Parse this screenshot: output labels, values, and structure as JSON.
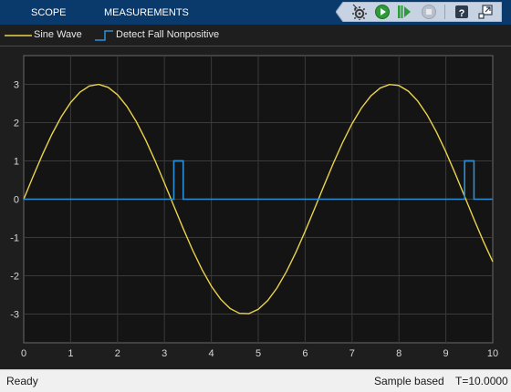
{
  "toolstrip": {
    "tabs": [
      {
        "label": "SCOPE"
      },
      {
        "label": "MEASUREMENTS"
      }
    ],
    "buttons": [
      {
        "name": "settings-button",
        "icon": "gear-icon"
      },
      {
        "name": "run-button",
        "icon": "play-icon"
      },
      {
        "name": "step-forward-button",
        "icon": "step-forward-icon"
      },
      {
        "name": "stop-button",
        "icon": "stop-icon"
      },
      {
        "name": "help-button",
        "icon": "help-icon"
      },
      {
        "name": "undock-button",
        "icon": "undock-icon"
      }
    ]
  },
  "legend": {
    "items": [
      {
        "label": "Sine Wave",
        "color": "#e9d24c"
      },
      {
        "label": "Detect Fall Nonpositive",
        "color": "#2c8fd6"
      }
    ]
  },
  "chart_data": {
    "type": "line",
    "title": "",
    "xlabel": "",
    "ylabel": "",
    "xlim": [
      0,
      10
    ],
    "ylim": [
      -3.75,
      3.75
    ],
    "grid": true,
    "x_ticks": [
      0,
      1,
      2,
      3,
      4,
      5,
      6,
      7,
      8,
      9,
      10
    ],
    "y_ticks": [
      3,
      2,
      1,
      0,
      -1,
      -2,
      -3
    ],
    "series": [
      {
        "name": "Sine Wave",
        "color": "#e9d24c",
        "function": "3*sin(t)",
        "sample_step": 0.2,
        "x": [
          0,
          0.2,
          0.4,
          0.6,
          0.8,
          1,
          1.2,
          1.4,
          1.6,
          1.8,
          2,
          2.2,
          2.4,
          2.6,
          2.8,
          3,
          3.2,
          3.4,
          3.6,
          3.8,
          4,
          4.2,
          4.4,
          4.6,
          4.8,
          5,
          5.2,
          5.4,
          5.6,
          5.8,
          6,
          6.2,
          6.4,
          6.6,
          6.8,
          7,
          7.2,
          7.4,
          7.6,
          7.8,
          8,
          8.2,
          8.4,
          8.6,
          8.8,
          9,
          9.2,
          9.4,
          9.6,
          9.8,
          10
        ],
        "y": [
          0,
          0.6,
          1.17,
          1.69,
          2.15,
          2.52,
          2.8,
          2.96,
          3.0,
          2.92,
          2.73,
          2.42,
          2.03,
          1.55,
          1.01,
          0.42,
          -0.17,
          -0.77,
          -1.33,
          -1.83,
          -2.27,
          -2.61,
          -2.86,
          -2.98,
          -2.99,
          -2.88,
          -2.65,
          -2.32,
          -1.9,
          -1.39,
          -0.84,
          -0.25,
          0.35,
          0.94,
          1.48,
          1.97,
          2.38,
          2.7,
          2.9,
          3.0,
          2.97,
          2.83,
          2.57,
          2.22,
          1.76,
          1.24,
          0.67,
          0.08,
          -0.52,
          -1.09,
          -1.63
        ]
      },
      {
        "name": "Detect Fall Nonpositive",
        "color": "#2c8fd6",
        "step": true,
        "x": [
          0,
          3.2,
          3.2,
          3.4,
          3.4,
          10
        ],
        "y": [
          0,
          0,
          1,
          1,
          0,
          0
        ],
        "pulses": [
          {
            "start": 3.2,
            "end": 3.4
          },
          {
            "start": 9.4,
            "end": 9.6
          }
        ]
      }
    ]
  },
  "status": {
    "left": "Ready",
    "mode": "Sample based",
    "time": "T=10.0000"
  }
}
